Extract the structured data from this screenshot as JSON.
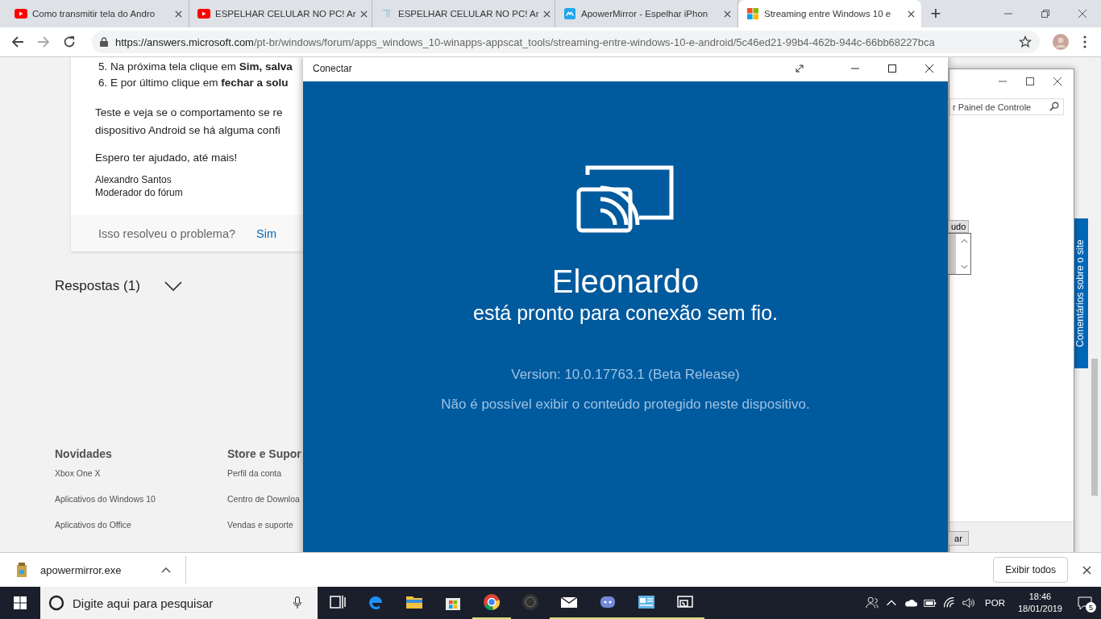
{
  "browser": {
    "tabs": [
      {
        "title": "Como transmitir tela do Andro",
        "kind": "video",
        "selected": false
      },
      {
        "title": "ESPELHAR CELULAR NO PC! Ar",
        "kind": "video",
        "selected": false
      },
      {
        "title": "ESPELHAR CELULAR NO PC! Ar",
        "kind": "document",
        "selected": false
      },
      {
        "title": "ApowerMirror - Espelhar iPhon",
        "kind": "app",
        "selected": false
      },
      {
        "title": "Streaming entre Windows 10 e",
        "kind": "site",
        "selected": true
      }
    ],
    "new_tab": "+",
    "url_host": "https://answers.microsoft.com",
    "url_path": "/pt-br/windows/forum/apps_windows_10-winapps-appscat_tools/streaming-entre-windows-10-e-android/5c46ed21-99b4-462b-944c-66bb68227bca"
  },
  "page": {
    "steps": [
      "5. Na próxima tela clique em **Sim, salva**",
      "6. E por último clique em **fechar a solu**"
    ],
    "paragraph": [
      "Teste e veja se o comportamento se re",
      "dispositivo Android se há alguma confi"
    ],
    "closing": "Espero ter ajudado, até mais!",
    "signature": [
      "Alexandro Santos",
      "Moderador do fórum"
    ],
    "question": "Isso resolveu o problema?",
    "yes": "Sim",
    "replies": "Respostas (1)",
    "footer": [
      {
        "heading": "Novidades",
        "links": [
          "Xbox One X",
          "Aplicativos do Windows 10",
          "Aplicativos do Office"
        ]
      },
      {
        "heading": "Store e Supor",
        "links": [
          "Perfil da conta",
          "Centro de Downloa",
          "Vendas e suporte"
        ]
      }
    ],
    "feedback_tab": "Comentários sobre o site"
  },
  "control_panel": {
    "search_placeholder": "r Painel de Controle",
    "button_1": "udo",
    "button_2": "ar"
  },
  "connect": {
    "title": "Conectar",
    "device": "Eleonardo",
    "status": "está pronto para conexão sem fio.",
    "version": "Version: 10.0.17763.1 (Beta Release)",
    "notice": "Não é possível exibir o conteúdo protegido neste dispositivo."
  },
  "downloads": {
    "file": "apowermirror.exe",
    "show_all": "Exibir todos"
  },
  "taskbar": {
    "search_placeholder": "Digite aqui para pesquisar",
    "apps": [
      {
        "kind": "taskview",
        "active": false
      },
      {
        "kind": "edge",
        "active": false
      },
      {
        "kind": "explorer",
        "active": false
      },
      {
        "kind": "store",
        "active": false
      },
      {
        "kind": "chrome",
        "active": true
      },
      {
        "kind": "nox",
        "active": false
      },
      {
        "kind": "mail",
        "active": true
      },
      {
        "kind": "discord",
        "active": true
      },
      {
        "kind": "panel",
        "active": true
      },
      {
        "kind": "connect",
        "active": true
      }
    ],
    "language": "POR",
    "time": "18:46",
    "date": "18/01/2019",
    "notifications": "5"
  }
}
